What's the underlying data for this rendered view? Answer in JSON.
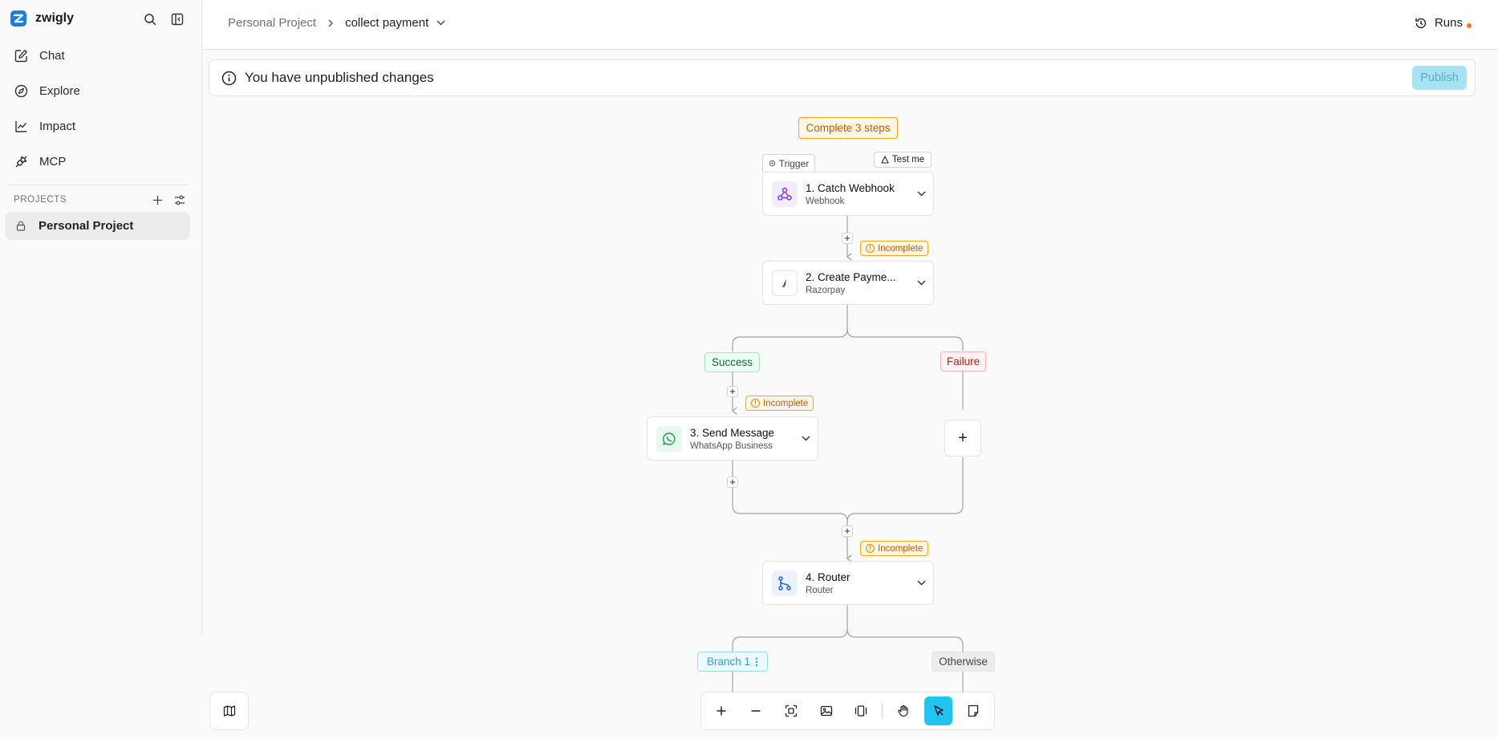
{
  "sidebar": {
    "brand": "zwigly",
    "nav": [
      {
        "label": "Chat",
        "icon": "edit-icon"
      },
      {
        "label": "Explore",
        "icon": "compass-icon"
      },
      {
        "label": "Impact",
        "icon": "chart-line-icon"
      },
      {
        "label": "MCP",
        "icon": "plug-icon"
      }
    ],
    "projects_title": "PROJECTS",
    "projects": [
      {
        "label": "Personal Project",
        "icon": "lock-icon"
      }
    ]
  },
  "header": {
    "breadcrumb_project": "Personal Project",
    "flow_name": "collect payment",
    "runs_label": "Runs"
  },
  "banner": {
    "message": "You have unpublished changes",
    "publish_label": "Publish"
  },
  "flow": {
    "complete_badge": "Complete 3 steps",
    "trigger_tag": "Trigger",
    "test_label": "Test me",
    "incomplete_label": "Incomplete",
    "steps": [
      {
        "title": "1. Catch Webhook",
        "subtitle": "Webhook"
      },
      {
        "title": "2. Create Payme...",
        "subtitle": "Razorpay"
      },
      {
        "title": "3. Send Message",
        "subtitle": "WhatsApp Business"
      },
      {
        "title": "4. Router",
        "subtitle": "Router"
      }
    ],
    "branches": {
      "success": "Success",
      "failure": "Failure",
      "branch1": "Branch 1",
      "otherwise": "Otherwise"
    }
  },
  "colors": {
    "accent": "#22c3ee",
    "warning": "#f5a524",
    "success": "#126b3a",
    "danger": "#b42318"
  }
}
